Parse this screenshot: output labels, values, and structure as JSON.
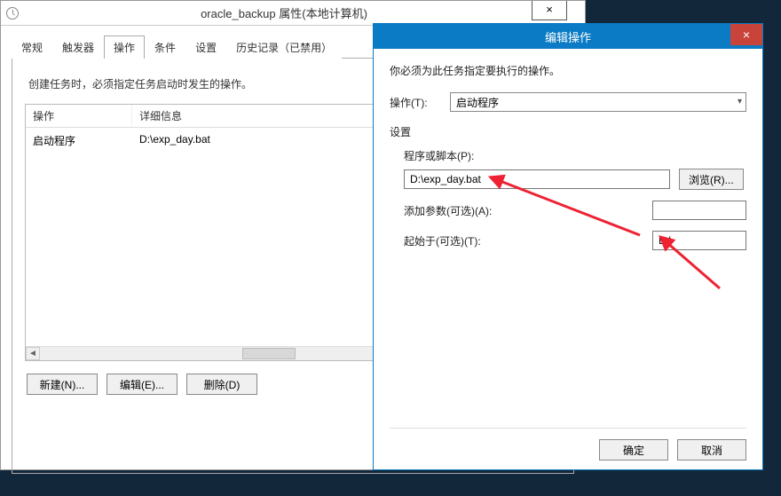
{
  "props_window": {
    "title": "oracle_backup 属性(本地计算机)",
    "close_x": "×",
    "tabs": [
      "常规",
      "触发器",
      "操作",
      "条件",
      "设置",
      "历史记录（已禁用）"
    ],
    "active_tab_index": 2,
    "instruction": "创建任务时，必须指定任务启动时发生的操作。",
    "list": {
      "headers": {
        "operation": "操作",
        "details": "详细信息"
      },
      "rows": [
        {
          "operation": "启动程序",
          "details": "D:\\exp_day.bat"
        }
      ]
    },
    "buttons": {
      "new": "新建(N)...",
      "edit": "编辑(E)...",
      "delete": "删除(D)"
    }
  },
  "edit_window": {
    "title": "编辑操作",
    "close_x": "×",
    "intro": "你必须为此任务指定要执行的操作。",
    "operation_label": "操作(T):",
    "operation_value": "启动程序",
    "settings_label": "设置",
    "script_label": "程序或脚本(P):",
    "script_value": "D:\\exp_day.bat",
    "browse": "浏览(R)...",
    "args_label": "添加参数(可选)(A):",
    "args_value": "",
    "startin_label": "起始于(可选)(T):",
    "startin_value": "D:\\",
    "ok": "确定",
    "cancel": "取消"
  }
}
